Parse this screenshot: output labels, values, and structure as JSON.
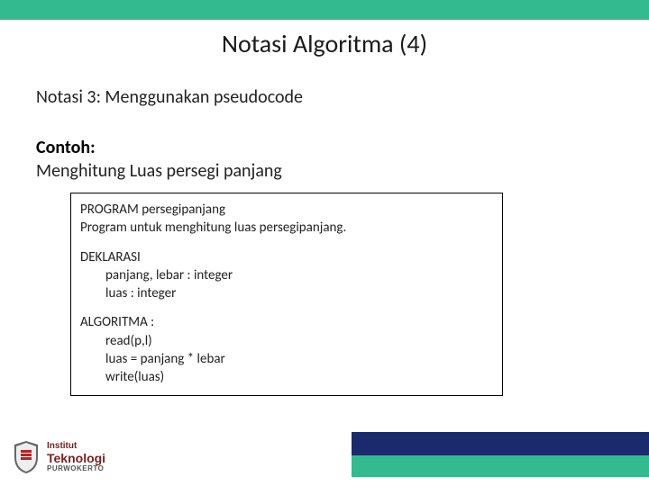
{
  "header": {
    "title": "Notasi Algoritma (4)"
  },
  "content": {
    "subheading": "Notasi 3: Menggunakan pseudocode",
    "example_label": "Contoh:",
    "example_desc": "Menghitung Luas persegi panjang"
  },
  "code": {
    "line1a": "PROGRAM",
    "line1b": "persegipanjang",
    "line2": "Program untuk menghitung luas persegipanjang.",
    "sec2_hdr": "DEKLARASI",
    "sec2_l1": "panjang, lebar : integer",
    "sec2_l2": "luas : integer",
    "sec3_hdr": "ALGORITMA :",
    "sec3_l1": "read(p,l)",
    "sec3_l2": "luas = panjang * lebar",
    "sec3_l3": "write(luas)"
  },
  "logo": {
    "line1": "Institut",
    "line2": "Teknologi",
    "line3": "PURWOKERTO"
  },
  "colors": {
    "teal": "#33bb8f",
    "navy": "#1a2a6c"
  }
}
